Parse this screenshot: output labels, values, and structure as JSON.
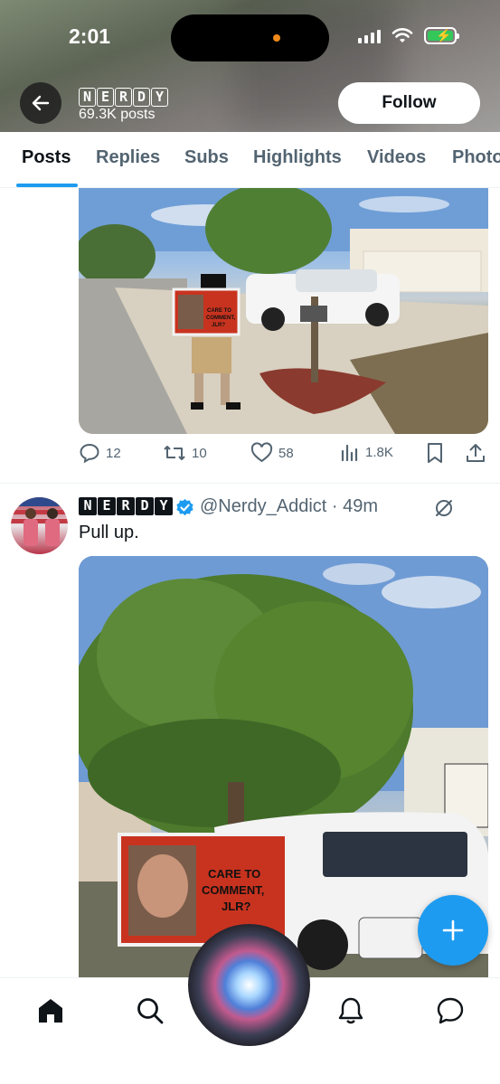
{
  "status_bar": {
    "time": "2:01"
  },
  "profile": {
    "name_letters": [
      "N",
      "E",
      "R",
      "D",
      "Y"
    ],
    "post_count": "69.3K posts",
    "follow_label": "Follow"
  },
  "tabs": [
    {
      "label": "Posts",
      "active": true
    },
    {
      "label": "Replies",
      "active": false
    },
    {
      "label": "Subs",
      "active": false
    },
    {
      "label": "Highlights",
      "active": false
    },
    {
      "label": "Videos",
      "active": false
    },
    {
      "label": "Photo",
      "active": false
    }
  ],
  "post1": {
    "sign_text": "CARE TO COMMENT, JLR?",
    "replies": "12",
    "reposts": "10",
    "likes": "58",
    "views": "1.8K"
  },
  "post2": {
    "name_letters": [
      "N",
      "E",
      "R",
      "D",
      "Y"
    ],
    "handle_time": "@Nerdy_Addict · 49m",
    "text": "Pull up.",
    "sign_text": "CARE TO COMMENT, JLR?"
  },
  "colors": {
    "accent": "#1d9bf0",
    "text": "#0f1419",
    "secondary": "#536471"
  },
  "icons": [
    "back-arrow-icon",
    "reply-icon",
    "repost-icon",
    "like-icon",
    "views-icon",
    "bookmark-icon",
    "share-icon",
    "verified-icon",
    "grok-icon",
    "plus-icon",
    "home-icon",
    "search-icon",
    "notifications-icon",
    "messages-icon"
  ]
}
